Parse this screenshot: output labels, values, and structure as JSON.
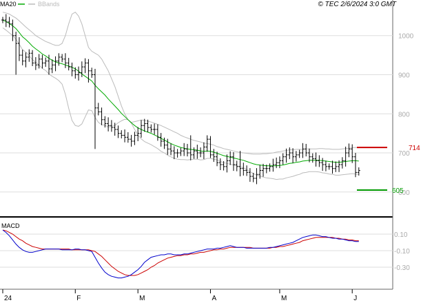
{
  "header": {
    "ma_label": "MA20",
    "bb_label": "BBands",
    "copyright": "© TEC 2/6/2024 3:0 GMT"
  },
  "colors": {
    "price": "#000000",
    "ma": "#00aa00",
    "bbands": "#bbbbbb",
    "resistance": "#cc0000",
    "support": "#009900",
    "macd": "#0000cc",
    "signal": "#cc0000",
    "grid": "#dddddd"
  },
  "levels": {
    "resistance": {
      "label": "714",
      "value": 714
    },
    "support": {
      "label": "605",
      "value": 605
    }
  },
  "macd_panel": {
    "title": "MACD"
  },
  "chart_data": [
    {
      "type": "line",
      "title": "",
      "series": [
        {
          "name": "MA20"
        },
        {
          "name": "BBands"
        }
      ],
      "y_ticks": [
        "1000",
        "900",
        "800",
        "700",
        "600"
      ],
      "y_tick_values": [
        1000,
        900,
        800,
        700,
        600
      ],
      "ylim": [
        545,
        1070
      ],
      "x_month_labels": [
        "24",
        "F",
        "M",
        "A",
        "M",
        "J"
      ],
      "x_month_index": [
        0,
        22,
        41,
        63,
        84,
        106
      ],
      "n_bars": 108,
      "close": [
        1040,
        1035,
        1030,
        1000,
        980,
        950,
        935,
        945,
        955,
        930,
        925,
        940,
        930,
        935,
        915,
        925,
        935,
        945,
        940,
        930,
        920,
        910,
        900,
        905,
        920,
        930,
        910,
        900,
        815,
        805,
        785,
        775,
        770,
        765,
        760,
        750,
        745,
        740,
        735,
        730,
        745,
        750,
        770,
        775,
        765,
        760,
        760,
        740,
        730,
        720,
        710,
        705,
        700,
        700,
        705,
        710,
        700,
        695,
        705,
        700,
        700,
        715,
        735,
        695,
        690,
        675,
        670,
        665,
        680,
        690,
        670,
        665,
        660,
        655,
        650,
        640,
        635,
        645,
        655,
        660,
        660,
        665,
        670,
        675,
        680,
        690,
        695,
        700,
        690,
        695,
        700,
        710,
        700,
        690,
        685,
        680,
        675,
        670,
        665,
        665,
        660,
        665,
        670,
        680,
        700,
        710,
        690,
        650,
        655
      ],
      "ma20": [
        1040,
        1036,
        1031,
        1025,
        1018,
        1008,
        997,
        990,
        982,
        973,
        966,
        960,
        953,
        948,
        942,
        937,
        933,
        930,
        928,
        925,
        922,
        919,
        915,
        909,
        902,
        896,
        890,
        884,
        873,
        864,
        856,
        848,
        838,
        829,
        820,
        811,
        801,
        793,
        785,
        777,
        770,
        764,
        760,
        756,
        753,
        750,
        746,
        742,
        737,
        733,
        728,
        724,
        720,
        717,
        714,
        712,
        710,
        709,
        708,
        707,
        705,
        704,
        705,
        704,
        702,
        699,
        696,
        693,
        691,
        689,
        687,
        685,
        683,
        681,
        678,
        675,
        672,
        670,
        669,
        668,
        667,
        667,
        667,
        667,
        668,
        669,
        671,
        673,
        674,
        676,
        677,
        679,
        680,
        681,
        681,
        681,
        681,
        680,
        679,
        678,
        677,
        676,
        676,
        677,
        678,
        679,
        680,
        680,
        679
      ],
      "bb_upper": [
        1060,
        1058,
        1055,
        1050,
        1045,
        1038,
        1030,
        1022,
        1015,
        1008,
        1000,
        995,
        990,
        985,
        982,
        978,
        975,
        975,
        980,
        1000,
        1030,
        1055,
        1060,
        1050,
        1030,
        1000,
        970,
        960,
        955,
        950,
        940,
        925,
        910,
        890,
        870,
        845,
        820,
        800,
        785,
        778,
        780,
        782,
        784,
        783,
        781,
        779,
        776,
        773,
        770,
        766,
        762,
        758,
        754,
        750,
        745,
        741,
        738,
        735,
        732,
        730,
        728,
        725,
        724,
        722,
        720,
        716,
        714,
        711,
        709,
        707,
        705,
        703,
        701,
        700,
        699,
        698,
        697,
        697,
        697,
        698,
        698,
        699,
        700,
        702,
        703,
        705,
        706,
        708,
        708,
        709,
        709,
        709,
        710,
        710,
        710,
        710,
        711,
        711,
        710,
        710,
        709,
        709,
        709,
        710,
        711,
        712,
        713,
        714,
        713
      ],
      "bb_lower": [
        1020,
        1014,
        1007,
        1000,
        991,
        978,
        964,
        958,
        949,
        938,
        932,
        925,
        916,
        911,
        902,
        896,
        891,
        885,
        876,
        850,
        814,
        783,
        770,
        768,
        774,
        792,
        810,
        808,
        791,
        778,
        772,
        771,
        766,
        768,
        770,
        777,
        782,
        786,
        785,
        776,
        760,
        746,
        736,
        729,
        725,
        721,
        716,
        711,
        704,
        700,
        694,
        690,
        686,
        684,
        683,
        683,
        682,
        683,
        684,
        684,
        682,
        683,
        686,
        686,
        684,
        682,
        678,
        675,
        673,
        671,
        669,
        667,
        665,
        662,
        657,
        652,
        647,
        643,
        641,
        638,
        636,
        635,
        634,
        632,
        633,
        633,
        636,
        638,
        640,
        643,
        645,
        649,
        650,
        652,
        652,
        652,
        651,
        649,
        648,
        646,
        645,
        643,
        643,
        644,
        645,
        646,
        647,
        646,
        645
      ],
      "extra_spikes": [
        {
          "index": 4,
          "low": 900,
          "high": 1010
        },
        {
          "index": 26,
          "low": 880,
          "high": 930
        },
        {
          "index": 28,
          "low": 710,
          "high": 820
        },
        {
          "index": 57,
          "low": 690,
          "high": 745
        },
        {
          "index": 72,
          "low": 640,
          "high": 705
        }
      ]
    },
    {
      "type": "line",
      "title": "MACD",
      "y_ticks": [
        "0.10",
        "-0.10",
        "-0.30"
      ],
      "y_tick_values": [
        0.1,
        -0.1,
        -0.3
      ],
      "ylim": [
        -0.55,
        0.25
      ],
      "macd": [
        0.15,
        0.12,
        0.08,
        0.03,
        -0.02,
        -0.06,
        -0.09,
        -0.11,
        -0.12,
        -0.12,
        -0.11,
        -0.1,
        -0.09,
        -0.08,
        -0.08,
        -0.08,
        -0.08,
        -0.08,
        -0.09,
        -0.09,
        -0.09,
        -0.09,
        -0.08,
        -0.08,
        -0.09,
        -0.09,
        -0.1,
        -0.11,
        -0.18,
        -0.25,
        -0.31,
        -0.36,
        -0.39,
        -0.41,
        -0.42,
        -0.43,
        -0.43,
        -0.42,
        -0.41,
        -0.39,
        -0.36,
        -0.33,
        -0.29,
        -0.24,
        -0.21,
        -0.18,
        -0.17,
        -0.16,
        -0.15,
        -0.15,
        -0.14,
        -0.14,
        -0.15,
        -0.15,
        -0.15,
        -0.14,
        -0.14,
        -0.13,
        -0.12,
        -0.11,
        -0.1,
        -0.09,
        -0.08,
        -0.08,
        -0.08,
        -0.07,
        -0.07,
        -0.06,
        -0.05,
        -0.04,
        -0.05,
        -0.06,
        -0.06,
        -0.06,
        -0.07,
        -0.07,
        -0.07,
        -0.07,
        -0.07,
        -0.07,
        -0.07,
        -0.06,
        -0.06,
        -0.05,
        -0.04,
        -0.03,
        -0.02,
        -0.01,
        0.0,
        0.02,
        0.04,
        0.06,
        0.07,
        0.08,
        0.09,
        0.09,
        0.08,
        0.07,
        0.07,
        0.06,
        0.05,
        0.05,
        0.04,
        0.04,
        0.03,
        0.02,
        0.02,
        0.01,
        0.01
      ],
      "signal": [
        0.15,
        0.14,
        0.12,
        0.1,
        0.07,
        0.04,
        0.02,
        -0.01,
        -0.03,
        -0.05,
        -0.06,
        -0.07,
        -0.08,
        -0.08,
        -0.08,
        -0.08,
        -0.08,
        -0.08,
        -0.08,
        -0.08,
        -0.08,
        -0.09,
        -0.09,
        -0.09,
        -0.09,
        -0.09,
        -0.09,
        -0.1,
        -0.11,
        -0.14,
        -0.17,
        -0.21,
        -0.25,
        -0.29,
        -0.32,
        -0.35,
        -0.37,
        -0.39,
        -0.4,
        -0.4,
        -0.4,
        -0.39,
        -0.37,
        -0.35,
        -0.33,
        -0.3,
        -0.28,
        -0.25,
        -0.23,
        -0.21,
        -0.19,
        -0.18,
        -0.17,
        -0.16,
        -0.16,
        -0.15,
        -0.15,
        -0.14,
        -0.14,
        -0.13,
        -0.12,
        -0.12,
        -0.11,
        -0.1,
        -0.09,
        -0.09,
        -0.08,
        -0.08,
        -0.07,
        -0.06,
        -0.06,
        -0.06,
        -0.06,
        -0.06,
        -0.06,
        -0.06,
        -0.07,
        -0.07,
        -0.07,
        -0.07,
        -0.07,
        -0.07,
        -0.06,
        -0.06,
        -0.05,
        -0.05,
        -0.04,
        -0.03,
        -0.02,
        -0.01,
        0.0,
        0.02,
        0.03,
        0.04,
        0.05,
        0.06,
        0.06,
        0.06,
        0.06,
        0.06,
        0.06,
        0.05,
        0.05,
        0.04,
        0.04,
        0.03,
        0.03,
        0.02,
        0.02
      ]
    }
  ]
}
